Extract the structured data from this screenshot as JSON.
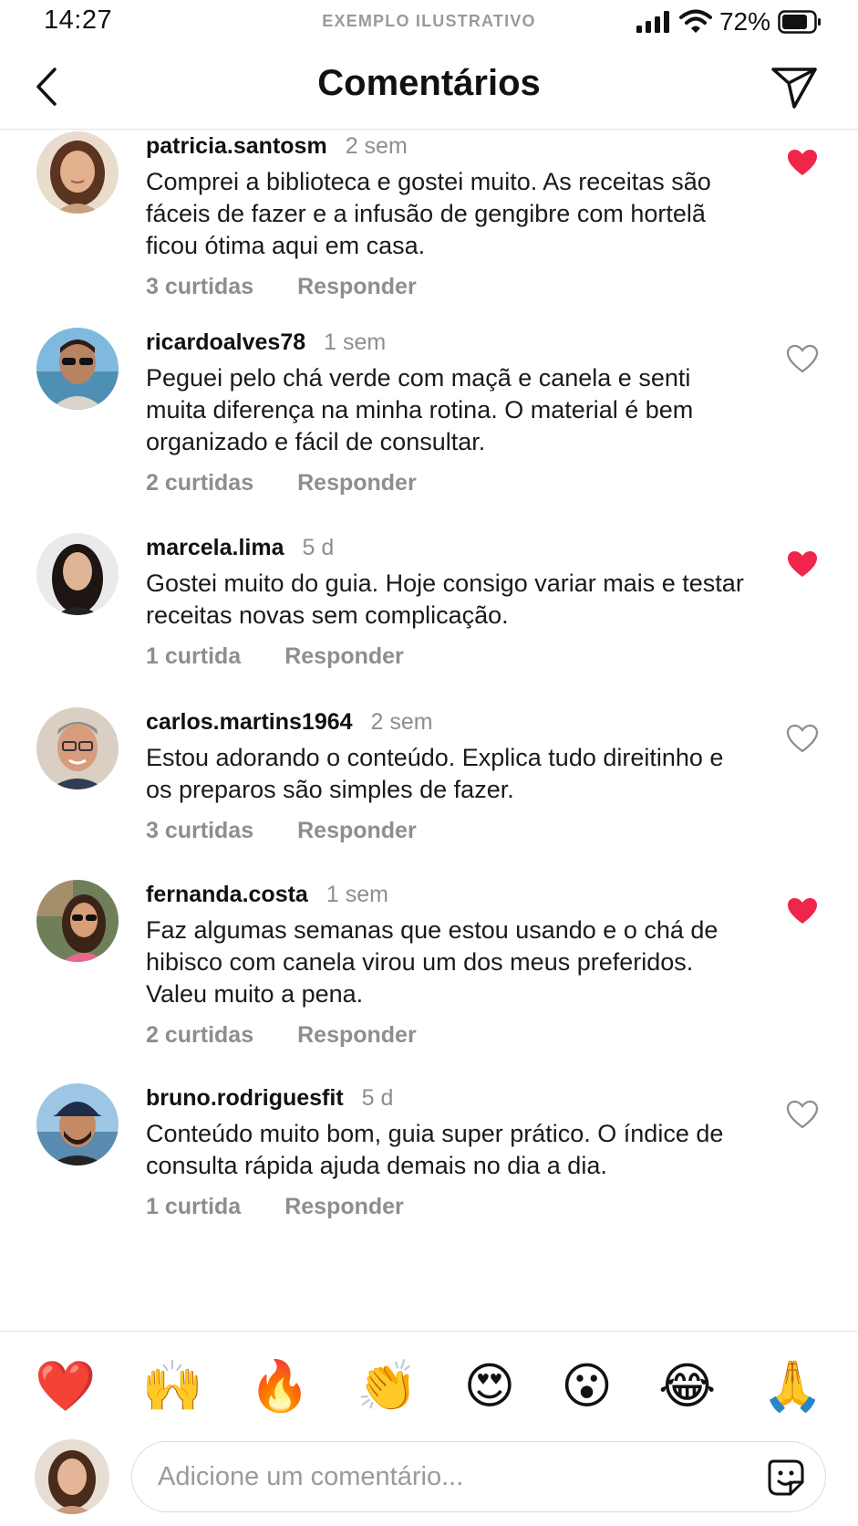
{
  "status_bar": {
    "time": "14:27",
    "center_label": "EXEMPLO ILUSTRATIVO",
    "battery": "72%",
    "icons": [
      "signal-icon",
      "wifi-icon",
      "battery-icon"
    ]
  },
  "header": {
    "title": "Comentários",
    "back_icon": "chevron-left-icon",
    "send_icon": "paper-plane-icon"
  },
  "colors": {
    "like_active": "#f0254a",
    "muted": "#8e8e8e",
    "text": "#111111"
  },
  "comments": [
    {
      "username": "patricia.santosm",
      "time": "2 sem",
      "text": "Comprei a biblioteca e gostei muito. As receitas são fáceis de fazer e a infusão de gengibre com hortelã ficou ótima aqui em casa.",
      "likes": "3 curtidas",
      "reply": "Responder",
      "liked": true
    },
    {
      "username": "ricardoalves78",
      "time": "1 sem",
      "text": "Peguei pelo chá verde com maçã e canela e senti muita diferença na minha rotina. O material é bem organizado e fácil de consultar.",
      "likes": "2 curtidas",
      "reply": "Responder",
      "liked": false
    },
    {
      "username": "marcela.lima",
      "time": "5 d",
      "text": "Gostei muito do guia. Hoje consigo variar mais e testar receitas novas sem complicação.",
      "likes": "1 curtida",
      "reply": "Responder",
      "liked": true
    },
    {
      "username": "carlos.martins1964",
      "time": "2 sem",
      "text": "Estou adorando o conteúdo. Explica tudo direitinho e os preparos são simples de fazer.",
      "likes": "3 curtidas",
      "reply": "Responder",
      "liked": false
    },
    {
      "username": "fernanda.costa",
      "time": "1 sem",
      "text": "Faz algumas semanas que estou usando e o chá de hibisco com canela virou um dos meus preferidos. Valeu muito a pena.",
      "likes": "2 curtidas",
      "reply": "Responder",
      "liked": true
    },
    {
      "username": "bruno.rodriguesfit",
      "time": "5 d",
      "text": "Conteúdo muito bom, guia super prático. O índice de consulta rápida ajuda demais no dia a dia.",
      "likes": "1 curtida",
      "reply": "Responder",
      "liked": false
    }
  ],
  "emoji_bar": [
    "❤️",
    "🙌",
    "🔥",
    "👏",
    "😍",
    "😮",
    "😂",
    "🙏"
  ],
  "composer": {
    "placeholder": "Adicione um comentário...",
    "value": "",
    "sticker_icon": "sticker-smile-icon"
  }
}
